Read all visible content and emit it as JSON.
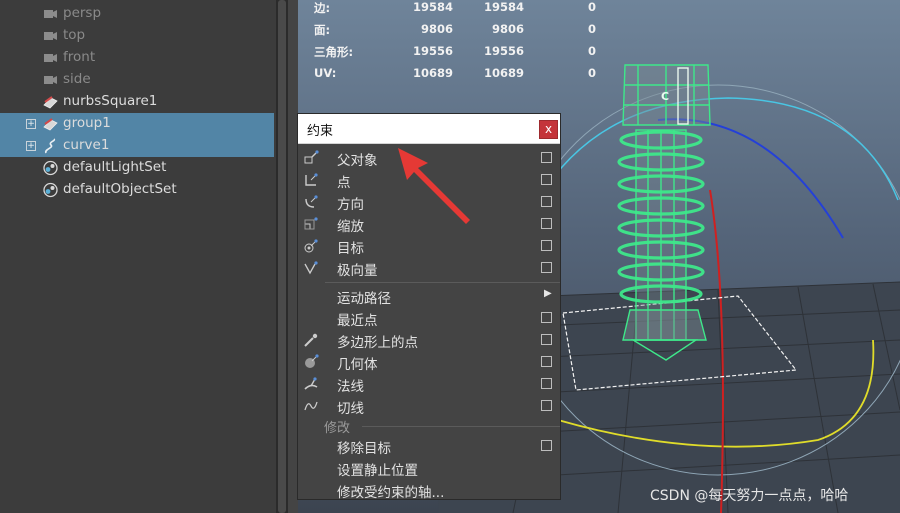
{
  "outliner": {
    "items": [
      {
        "label": "persp",
        "icon": "camera-icon",
        "selected": false,
        "expandable": false
      },
      {
        "label": "top",
        "icon": "camera-icon",
        "selected": false,
        "expandable": false
      },
      {
        "label": "front",
        "icon": "camera-icon",
        "selected": false,
        "expandable": false
      },
      {
        "label": "side",
        "icon": "camera-icon",
        "selected": false,
        "expandable": false
      },
      {
        "label": "nurbsSquare1",
        "icon": "nurbs-square-icon",
        "selected": false,
        "expandable": false
      },
      {
        "label": "group1",
        "icon": "group-icon",
        "selected": true,
        "expandable": true,
        "expander": "+"
      },
      {
        "label": "curve1",
        "icon": "curve-icon",
        "selected": true,
        "expandable": true,
        "expander": "+"
      },
      {
        "label": "defaultLightSet",
        "icon": "set-icon",
        "selected": false,
        "expandable": false
      },
      {
        "label": "defaultObjectSet",
        "icon": "set-icon",
        "selected": false,
        "expandable": false
      }
    ]
  },
  "hud": {
    "rows": [
      {
        "label": "边:",
        "v1": "19584",
        "v2": "19584",
        "v3": "0"
      },
      {
        "label": "面:",
        "v1": "9806",
        "v2": "9806",
        "v3": "0"
      },
      {
        "label": "三角形:",
        "v1": "19556",
        "v2": "19556",
        "v3": "0"
      },
      {
        "label": "UV:",
        "v1": "10689",
        "v2": "10689",
        "v3": "0"
      }
    ]
  },
  "viewport": {
    "screw_label": "C",
    "watermark": "CSDN @每天努力一点点，哈哈"
  },
  "menu": {
    "title": "约束",
    "close_label": "x",
    "group1": [
      {
        "label": "父对象",
        "icon": "parent-constraint-icon",
        "option_box": true
      },
      {
        "label": "点",
        "icon": "point-constraint-icon",
        "option_box": true
      },
      {
        "label": "方向",
        "icon": "orient-constraint-icon",
        "option_box": true
      },
      {
        "label": "缩放",
        "icon": "scale-constraint-icon",
        "option_box": true
      },
      {
        "label": "目标",
        "icon": "aim-constraint-icon",
        "option_box": true
      },
      {
        "label": "极向量",
        "icon": "pole-vector-icon",
        "option_box": true
      }
    ],
    "group2": [
      {
        "label": "运动路径",
        "icon": "",
        "submenu": true
      },
      {
        "label": "最近点",
        "icon": "",
        "option_box": true
      },
      {
        "label": "多边形上的点",
        "icon": "point-on-poly-icon",
        "option_box": true
      },
      {
        "label": "几何体",
        "icon": "geometry-constraint-icon",
        "option_box": true
      },
      {
        "label": "法线",
        "icon": "normal-constraint-icon",
        "option_box": true
      },
      {
        "label": "切线",
        "icon": "tangent-constraint-icon",
        "option_box": true
      }
    ],
    "section_label": "修改",
    "group3": [
      {
        "label": "移除目标",
        "option_box": true
      },
      {
        "label": "设置静止位置",
        "option_box": false
      },
      {
        "label": "修改受约束的轴...",
        "option_box": false
      }
    ]
  },
  "colors": {
    "selection": "#5285a6",
    "screw": "#3ee88a",
    "annotation_arrow": "#e53935"
  }
}
